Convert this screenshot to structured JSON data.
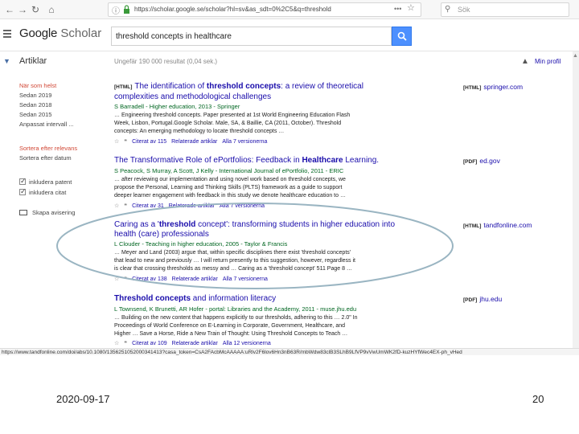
{
  "browser": {
    "url": "https://scholar.google.se/scholar?hl=sv&as_sdt=0%2C5&q=threshold",
    "url_more": "•••",
    "search_placeholder": "Sök"
  },
  "header": {
    "logo_google": "Google",
    "logo_scholar": "Scholar",
    "query": "threshold concepts in healthcare"
  },
  "subheader": {
    "section": "Artiklar",
    "result_count": "Ungefär 190 000 resultat (0,04 sek.)",
    "profile": "Min profil"
  },
  "sidebar": {
    "time_items": [
      "När som helst",
      "Sedan 2019",
      "Sedan 2018",
      "Sedan 2015",
      "Anpassat intervall ..."
    ],
    "sort_items": [
      "Sortera efter relevans",
      "Sortera efter datum"
    ],
    "checkbox_patents": "inkludera patent",
    "checkbox_citations": "inkludera citat",
    "alert": "Skapa avisering"
  },
  "results": [
    {
      "tag": "[HTML]",
      "title_1": "The identification of",
      "title_bold": "threshold concepts",
      "title_2": ": a review of theoretical",
      "title_line2": "complexities and methodological challenges",
      "meta": "S Barradell - Higher education, 2013 - Springer",
      "snippet": [
        "… Engineering threshold concepts. Paper presented at 1st World Engineering Education Flash",
        "Week, Lisbon, Portugal.Google Scholar. Male, SA, & Baillie, CA (2011, October). Threshold",
        "concepts: An emerging methodology to locate threshold concepts …"
      ],
      "cited": "Citerat av 115",
      "related": "Relaterade artiklar",
      "versions": "Alla 7 versionerna",
      "side_tag": "[HTML]",
      "side_source": "springer.com"
    },
    {
      "tag": "",
      "title_1": "The Transformative Role of ePortfolios: Feedback in",
      "title_bold": "Healthcare",
      "title_2": " Learning.",
      "title_line2": "",
      "meta": "S Peacock, S Murray, A Scott, J Kelly - International Journal of ePortfolio, 2011 - ERIC",
      "snippet": [
        "… after reviewing our implementation and using novel work based on threshold concepts, we",
        "propose the Personal, Learning and Thinking Skills (PLTS) framework as a guide to support",
        "deeper learner engagement with feedback in this study we denote healthcare education to …"
      ],
      "cited": "Citerat av 31",
      "related": "Relaterade artiklar",
      "versions": "Alla 7 versionerna",
      "side_tag": "[PDF]",
      "side_source": "ed.gov"
    },
    {
      "tag": "",
      "title_1": "Caring as a '",
      "title_bold": "threshold",
      "title_2": " concept': transforming students in higher education into",
      "title_line2": "health (care) professionals",
      "meta": "L Clouder - Teaching in higher education, 2005 - Taylor & Francis",
      "snippet": [
        "… Meyer and Land (2003) argue that, within specific disciplines there exist 'threshold concepts'",
        "that lead to new and previously … I will return presently to this suggestion, however, regardless it",
        "is clear that crossing thresholds as messy and … Caring as a 'threshold concept' 511 Page 8 …"
      ],
      "cited": "Citerat av 138",
      "related": "Relaterade artiklar",
      "versions": "Alla 7 versionerna",
      "side_tag": "[HTML]",
      "side_source": "tandfonline.com"
    },
    {
      "tag": "",
      "title_1": "",
      "title_bold": "Threshold concepts",
      "title_2": " and information literacy",
      "title_line2": "",
      "meta": "L Townsend, K Brunetti, AR Hofer - portal: Libraries and the Academy, 2011 - muse.jhu.edu",
      "snippet": [
        "… Building on the new content that happens explicitly to our thresholds, adhering to this … 2.0\" In",
        "Proceedings of World Conference on E-Learning in Corporate, Government, Healthcare, and",
        "Higher … Save a Horse, Ride a New Train of Thought: Using Threshold Concepts to Teach …"
      ],
      "cited": "Citerat av 109",
      "related": "Relaterade artiklar",
      "versions": "Alla 12 versionerna",
      "side_tag": "[PDF]",
      "side_source": "jhu.edu"
    }
  ],
  "statusbar": "https://www.tandfonline.com/doi/abs/10.1080/1356251052000341413?casa_token=CsA2FAcbMcAAAAA:uRlv2F6lov6Hn3nB63R/mbWdw83clB3SLhB9LfVP9vVwUmWK2fD-kuzHYfWec4EX-ph_vHed",
  "footer": {
    "date": "2020-09-17",
    "page": "20"
  },
  "colors": {
    "link": "#1a0dab",
    "meta": "#006621",
    "search_button": "#4d90fe",
    "sidebar_active": "#d14836",
    "highlight_ellipse": "#9ab5c2"
  }
}
